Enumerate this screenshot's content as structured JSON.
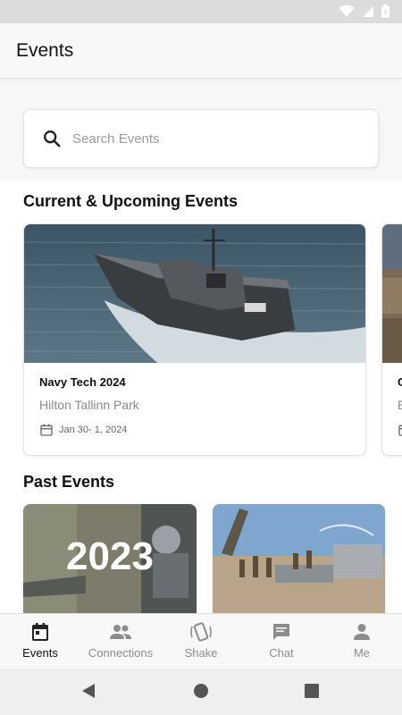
{
  "app_title": "Events",
  "search": {
    "placeholder": "Search Events"
  },
  "sections": {
    "current_title": "Current & Upcoming Events",
    "past_title": "Past Events"
  },
  "current_events": [
    {
      "name": "Navy Tech 2024",
      "venue": "Hilton Tallinn Park",
      "date": "Jan 30- 1, 2024",
      "image": "stealth boat on water"
    },
    {
      "name": "C",
      "venue": "E",
      "date": ""
    }
  ],
  "past_events": [
    {
      "banner_text": "2023",
      "image": "2023 military collage"
    },
    {
      "banner_text": "",
      "image": "soldiers at equipment site"
    }
  ],
  "bottom_nav": [
    {
      "label": "Events",
      "icon": "calendar-icon",
      "active": true
    },
    {
      "label": "Connections",
      "icon": "people-icon",
      "active": false
    },
    {
      "label": "Shake",
      "icon": "shake-icon",
      "active": false
    },
    {
      "label": "Chat",
      "icon": "chat-icon",
      "active": false
    },
    {
      "label": "Me",
      "icon": "person-icon",
      "active": false
    }
  ],
  "colors": {
    "active_nav": "#111111",
    "inactive_nav": "#8c8c8c",
    "muted_text": "#8a8a8a"
  }
}
